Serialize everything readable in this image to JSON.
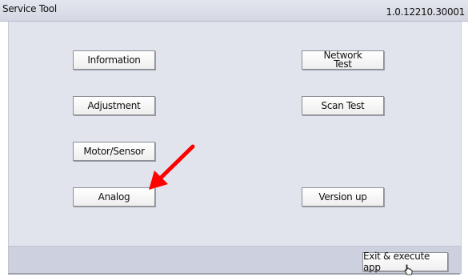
{
  "window": {
    "title": "Service Tool",
    "version": "1.0.12210.30001"
  },
  "menu": {
    "information": "Information",
    "adjustment": "Adjustment",
    "motor_sensor": "Motor/Sensor",
    "analog": "Analog",
    "network_test_line1": "Network",
    "network_test_line2": "Test",
    "scan_test": "Scan Test",
    "version_up": "Version up"
  },
  "footer": {
    "exit_label": "Exit & execute app"
  },
  "annotation": {
    "arrow_color": "#ff0000",
    "arrow_target": "Analog"
  },
  "colors": {
    "titlebar": "#d4d7e2",
    "panel": "#e2e4ed",
    "footer": "#cdd1df"
  }
}
